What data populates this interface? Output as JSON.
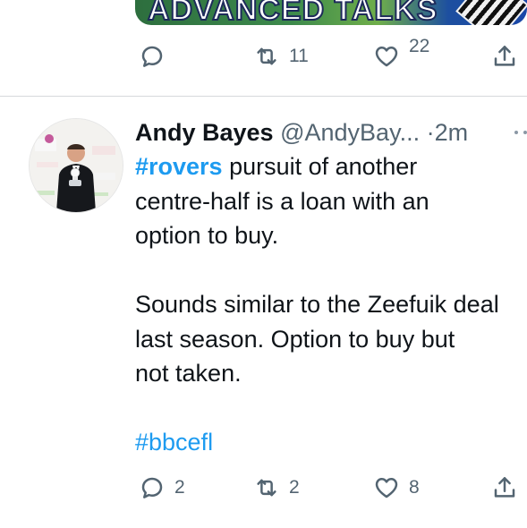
{
  "previous_tweet": {
    "media_banner_text": "ADVANCED TALKS",
    "actions": {
      "reply_count": "",
      "retweet_count": "11",
      "like_count": "22",
      "share_count": ""
    }
  },
  "tweet": {
    "author": {
      "display_name": "Andy Bayes",
      "handle": "@AndyBay...",
      "separator": "·",
      "timestamp": "2m"
    },
    "body": {
      "line1_hashtag": "#rovers",
      "line1_text": " pursuit of another",
      "line2": "centre-half is a loan with an",
      "line3": "option to buy.",
      "line4": "Sounds similar to the Zeefuik deal",
      "line5": "last season.  Option to buy but",
      "line6": "not taken.",
      "hashtag2": "#bbcefl"
    },
    "actions": {
      "reply_count": "2",
      "retweet_count": "2",
      "like_count": "8"
    }
  },
  "colors": {
    "accent": "#1d9bf0",
    "text_primary": "#0f1419",
    "text_secondary": "#536471",
    "divider": "#d6d9db"
  },
  "icons": {
    "reply": "speech-bubble",
    "retweet": "retweet-arrows",
    "like": "heart",
    "share": "share-upload",
    "more": "more-dots"
  }
}
